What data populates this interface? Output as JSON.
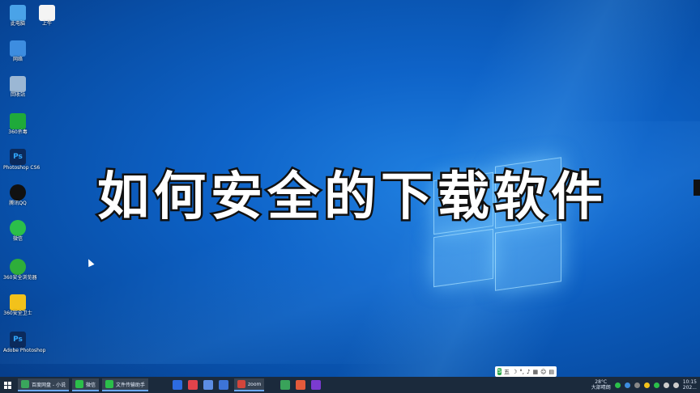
{
  "title_overlay": "如何安全的下载软件",
  "desktop_icons": [
    {
      "label": "此电脑",
      "icon": "computer-icon",
      "color": "#4aa3e8"
    },
    {
      "label": "网络",
      "icon": "network-icon",
      "color": "#3d8de0"
    },
    {
      "label": "回收站",
      "icon": "recycle-bin-icon",
      "color": "#9bb7d4"
    },
    {
      "label": "360杀毒",
      "icon": "shield-icon",
      "color": "#1faa3a"
    },
    {
      "label": "Photoshop CS6",
      "icon": "photoshop-icon",
      "color": "#0b2a5c"
    },
    {
      "label": "腾讯QQ",
      "icon": "qq-penguin-icon",
      "color": "#111111"
    },
    {
      "label": "微信",
      "icon": "wechat-icon",
      "color": "#2bbf4a"
    },
    {
      "label": "360安全浏览器",
      "icon": "browser-e-icon",
      "color": "#2eae3a"
    },
    {
      "label": "360安全卫士",
      "icon": "plus-shield-icon",
      "color": "#f2c21b"
    },
    {
      "label": "Adobe Photoshop",
      "icon": "photoshop-icon",
      "color": "#0b2a5c"
    },
    {
      "label": "上午",
      "icon": "document-icon",
      "color": "#f4f4f4"
    }
  ],
  "ime_bar": {
    "brand": "S",
    "mode": "五"
  },
  "taskbar": {
    "apps": [
      {
        "label": "百度网盘 - 小说",
        "color": "#3aa55c"
      },
      {
        "label": "微信",
        "color": "#2bbf4a"
      },
      {
        "label": "文件传输助手",
        "color": "#2bbf4a"
      }
    ],
    "pinned_icons": [
      {
        "name": "chrome-icon",
        "color": "#2d6be0"
      },
      {
        "name": "xmind-icon",
        "color": "#e2434b"
      },
      {
        "name": "settings-icon",
        "color": "#5c8de3"
      },
      {
        "name": "shield-app-icon",
        "color": "#3d74d8"
      },
      {
        "name": "terminal-icon",
        "color": "#d2453b"
      },
      {
        "name": "media-player-icon",
        "color": "#39a35a"
      },
      {
        "name": "store-icon",
        "color": "#e35a3b"
      },
      {
        "name": "camera-app-icon",
        "color": "#7b3bd0"
      }
    ],
    "pinned_app_label": "zoom",
    "weather": "28°C",
    "weather_sub": "大部晴朗",
    "clock": "10:15",
    "date": "202..."
  }
}
